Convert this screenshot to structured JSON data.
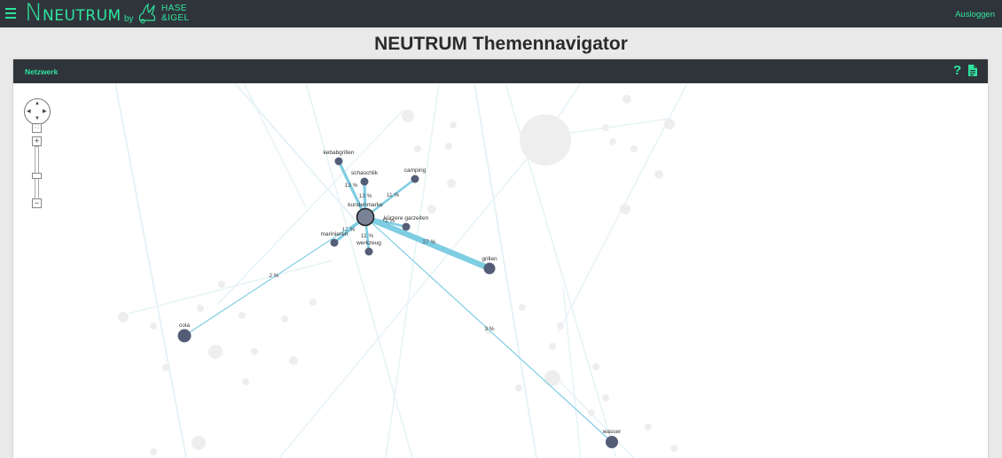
{
  "app": {
    "logo_letter": "N",
    "logo_name": "NEUTRUM",
    "logo_by": "by",
    "partner_line1": "HASE",
    "partner_line2": "&IGEL",
    "logout_label": "Ausloggen"
  },
  "page_title": "NEUTRUM Themennavigator",
  "panel": {
    "title": "Netzwerk",
    "help_label": "?"
  },
  "network": {
    "center": {
      "name": "kundenmarke"
    },
    "nodes": [
      {
        "name": "kebabgrillen",
        "percent": "13 %"
      },
      {
        "name": "schaschlik",
        "percent": "13 %"
      },
      {
        "name": "camping",
        "percent": "11 %"
      },
      {
        "name": "kürzere garzeiten",
        "percent": "11 %"
      },
      {
        "name": "marinieren",
        "percent": "12 %"
      },
      {
        "name": "werkzeug",
        "percent": "11 %"
      },
      {
        "name": "grillen",
        "percent": "27 %"
      },
      {
        "name": "cola",
        "percent": "2 %"
      },
      {
        "name": "wasser",
        "percent": "3 %"
      }
    ]
  },
  "colors": {
    "accent": "#2ee59d",
    "header_bg": "#2f343b",
    "node_fill": "#545d77",
    "edge": "#7ecde3"
  }
}
